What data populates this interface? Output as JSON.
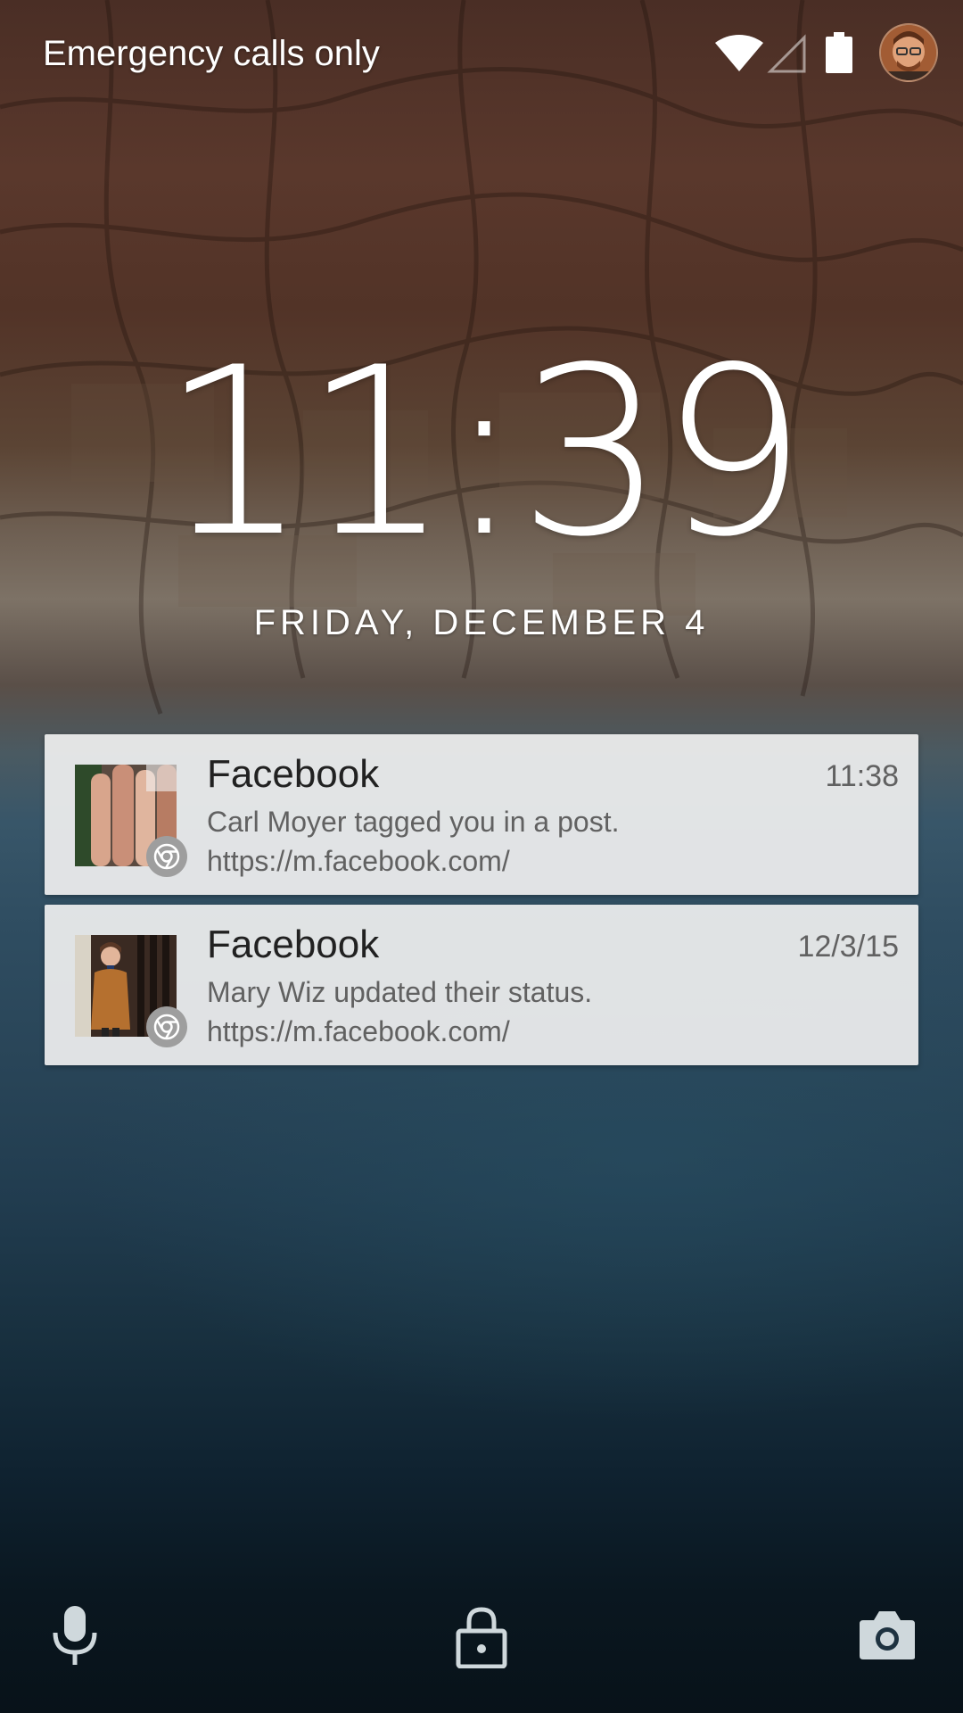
{
  "status_bar": {
    "carrier_text": "Emergency calls only",
    "icons": [
      "wifi-icon",
      "cell-signal-icon",
      "battery-icon",
      "user-avatar"
    ]
  },
  "clock": {
    "time": "11:39",
    "date": "FRIDAY, DECEMBER 4"
  },
  "notifications": [
    {
      "app": "Facebook",
      "time": "11:38",
      "text": "Carl Moyer tagged you in a post.",
      "url": "https://m.facebook.com/",
      "badge_icon": "chrome-icon"
    },
    {
      "app": "Facebook",
      "time": "12/3/15",
      "text": "Mary Wiz updated their status.",
      "url": "https://m.facebook.com/",
      "badge_icon": "chrome-icon"
    }
  ],
  "bottom_bar": {
    "icons": [
      "microphone-icon",
      "lock-icon",
      "camera-icon"
    ]
  },
  "colors": {
    "notification_bg": "#f0f0f0",
    "text_primary": "#212121",
    "text_secondary": "#616161",
    "badge_gray": "#9e9e9e"
  }
}
